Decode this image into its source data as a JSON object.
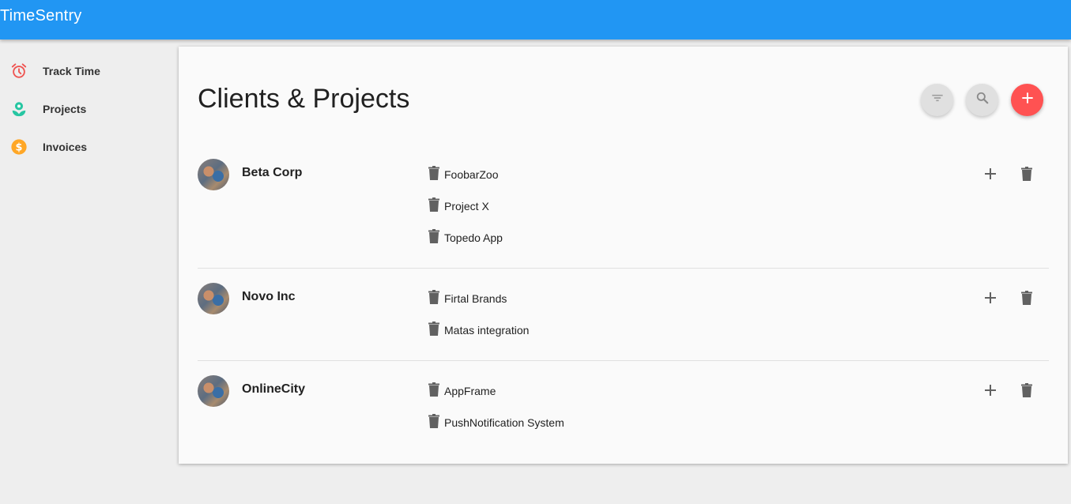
{
  "app": {
    "title": "TimeSentry"
  },
  "colors": {
    "appbar": "#2196f3",
    "accent": "#ff5252",
    "track_icon": "#ef5350",
    "projects_icon": "#26c6a2",
    "invoices_icon": "#ffa726"
  },
  "sidebar": {
    "items": [
      {
        "label": "Track Time",
        "icon": "alarm-clock-icon"
      },
      {
        "label": "Projects",
        "icon": "projects-icon"
      },
      {
        "label": "Invoices",
        "icon": "dollar-icon"
      }
    ]
  },
  "main": {
    "title": "Clients & Projects",
    "actions": [
      "filter-icon",
      "search-icon",
      "add-icon"
    ],
    "clients": [
      {
        "name": "Beta Corp",
        "projects": [
          "FoobarZoo",
          "Project X",
          "Topedo App"
        ]
      },
      {
        "name": "Novo Inc",
        "projects": [
          "Firtal Brands",
          "Matas integration"
        ]
      },
      {
        "name": "OnlineCity",
        "projects": [
          "AppFrame",
          "PushNotification System"
        ]
      }
    ]
  }
}
